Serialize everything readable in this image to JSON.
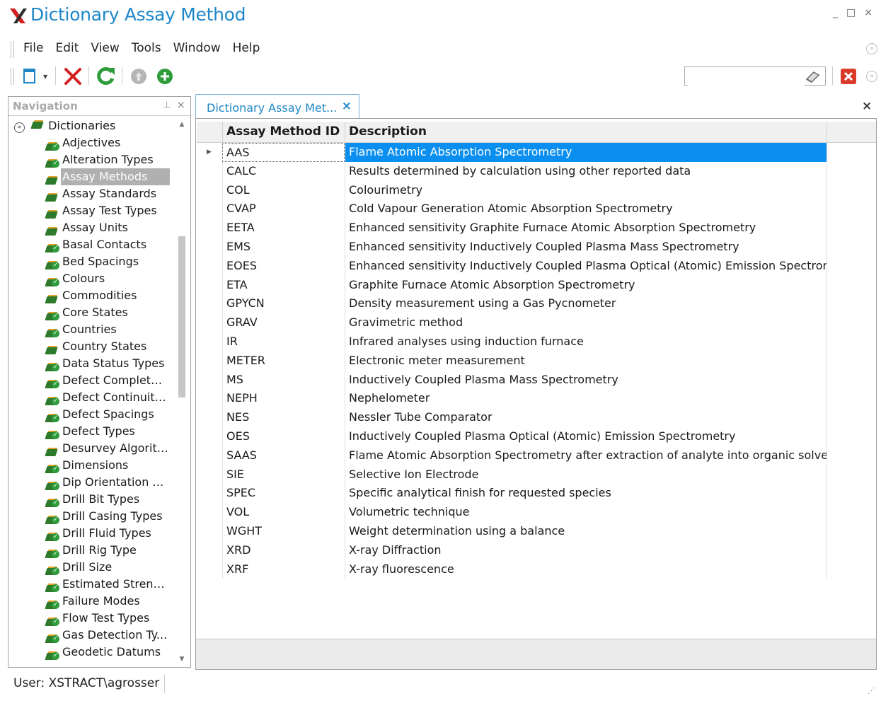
{
  "app": {
    "title": "Dictionary Assay Method",
    "controls": {
      "minimize": "_",
      "maximize": "□",
      "close": "×"
    }
  },
  "menu": [
    "File",
    "Edit",
    "View",
    "Tools",
    "Window",
    "Help"
  ],
  "toolbar": {
    "buttons": [
      "new-icon",
      "dropdown-arrow-icon",
      "delete-icon",
      "refresh-icon",
      "up-icon",
      "add-icon"
    ],
    "search": {
      "value": "",
      "placeholder": ""
    },
    "colors": {
      "delete": "#d42020",
      "refresh": "#2e9c3a",
      "add": "#2e9c3a",
      "close_red": "#d93a2a"
    }
  },
  "navigation": {
    "title": "Navigation",
    "root": "Dictionaries",
    "selected": "Assay Methods",
    "items": [
      {
        "label": "Adjectives",
        "icon": "book-check-icon"
      },
      {
        "label": "Alteration Types",
        "icon": "book-check-icon"
      },
      {
        "label": "Assay Methods",
        "icon": "book-icon"
      },
      {
        "label": "Assay Standards",
        "icon": "book-icon"
      },
      {
        "label": "Assay Test Types",
        "icon": "book-icon"
      },
      {
        "label": "Assay Units",
        "icon": "book-icon"
      },
      {
        "label": "Basal Contacts",
        "icon": "book-check-icon"
      },
      {
        "label": "Bed Spacings",
        "icon": "book-check-icon"
      },
      {
        "label": "Colours",
        "icon": "book-check-icon"
      },
      {
        "label": "Commodities",
        "icon": "book-icon"
      },
      {
        "label": "Core States",
        "icon": "book-check-icon"
      },
      {
        "label": "Countries",
        "icon": "book-check-icon"
      },
      {
        "label": "Country States",
        "icon": "book-icon"
      },
      {
        "label": "Data Status Types",
        "icon": "book-check-icon"
      },
      {
        "label": "Defect Complete...",
        "icon": "book-check-icon"
      },
      {
        "label": "Defect Continuity ...",
        "icon": "book-check-icon"
      },
      {
        "label": "Defect Spacings",
        "icon": "book-check-icon"
      },
      {
        "label": "Defect Types",
        "icon": "book-check-icon"
      },
      {
        "label": "Desurvey Algorith...",
        "icon": "book-icon"
      },
      {
        "label": "Dimensions",
        "icon": "book-check-icon"
      },
      {
        "label": "Dip Orientation M...",
        "icon": "book-check-icon"
      },
      {
        "label": "Drill Bit Types",
        "icon": "book-check-icon"
      },
      {
        "label": "Drill Casing Types",
        "icon": "book-check-icon"
      },
      {
        "label": "Drill Fluid Types",
        "icon": "book-check-icon"
      },
      {
        "label": "Drill Rig Type",
        "icon": "book-check-icon"
      },
      {
        "label": "Drill Size",
        "icon": "book-check-icon"
      },
      {
        "label": "Estimated Strength",
        "icon": "book-check-icon"
      },
      {
        "label": "Failure Modes",
        "icon": "book-check-icon"
      },
      {
        "label": "Flow Test Types",
        "icon": "book-check-icon"
      },
      {
        "label": "Gas Detection Ty...",
        "icon": "book-check-icon"
      },
      {
        "label": "Geodetic Datums",
        "icon": "book-check-icon"
      }
    ]
  },
  "document": {
    "tab_label": "Dictionary Assay Met...",
    "columns": [
      "Assay Method ID",
      "Description"
    ],
    "rows": [
      {
        "id": "AAS",
        "description": "Flame Atomic Absorption Spectrometry",
        "selected": true
      },
      {
        "id": "CALC",
        "description": "Results determined by calculation using other reported data"
      },
      {
        "id": "COL",
        "description": "Colourimetry"
      },
      {
        "id": "CVAP",
        "description": "Cold Vapour Generation Atomic Absorption Spectrometry"
      },
      {
        "id": "EETA",
        "description": "Enhanced sensitivity Graphite Furnace Atomic Absorption Spectrometry"
      },
      {
        "id": "EMS",
        "description": "Enhanced sensitivity Inductively Coupled Plasma Mass Spectrometry"
      },
      {
        "id": "EOES",
        "description": "Enhanced sensitivity Inductively Coupled Plasma Optical (Atomic) Emission Spectrometry"
      },
      {
        "id": "ETA",
        "description": "Graphite Furnace Atomic Absorption Spectrometry"
      },
      {
        "id": "GPYCN",
        "description": "Density measurement using a Gas Pycnometer"
      },
      {
        "id": "GRAV",
        "description": "Gravimetric method"
      },
      {
        "id": "IR",
        "description": "Infrared analyses using induction furnace"
      },
      {
        "id": "METER",
        "description": "Electronic meter measurement"
      },
      {
        "id": "MS",
        "description": "Inductively Coupled Plasma Mass Spectrometry"
      },
      {
        "id": "NEPH",
        "description": "Nephelometer"
      },
      {
        "id": "NES",
        "description": "Nessler Tube Comparator"
      },
      {
        "id": "OES",
        "description": "Inductively Coupled Plasma Optical (Atomic) Emission Spectrometry"
      },
      {
        "id": "SAAS",
        "description": "Flame Atomic Absorption Spectrometry after extraction of analyte into organic solvent"
      },
      {
        "id": "SIE",
        "description": "Selective Ion Electrode"
      },
      {
        "id": "SPEC",
        "description": "Specific analytical finish for requested species"
      },
      {
        "id": "VOL",
        "description": "Volumetric technique"
      },
      {
        "id": "WGHT",
        "description": "Weight determination using a balance"
      },
      {
        "id": "XRD",
        "description": "X-ray Diffraction"
      },
      {
        "id": "XRF",
        "description": "X-ray fluorescence"
      }
    ]
  },
  "status": {
    "user": "User: XSTRACT\\agrosser"
  }
}
